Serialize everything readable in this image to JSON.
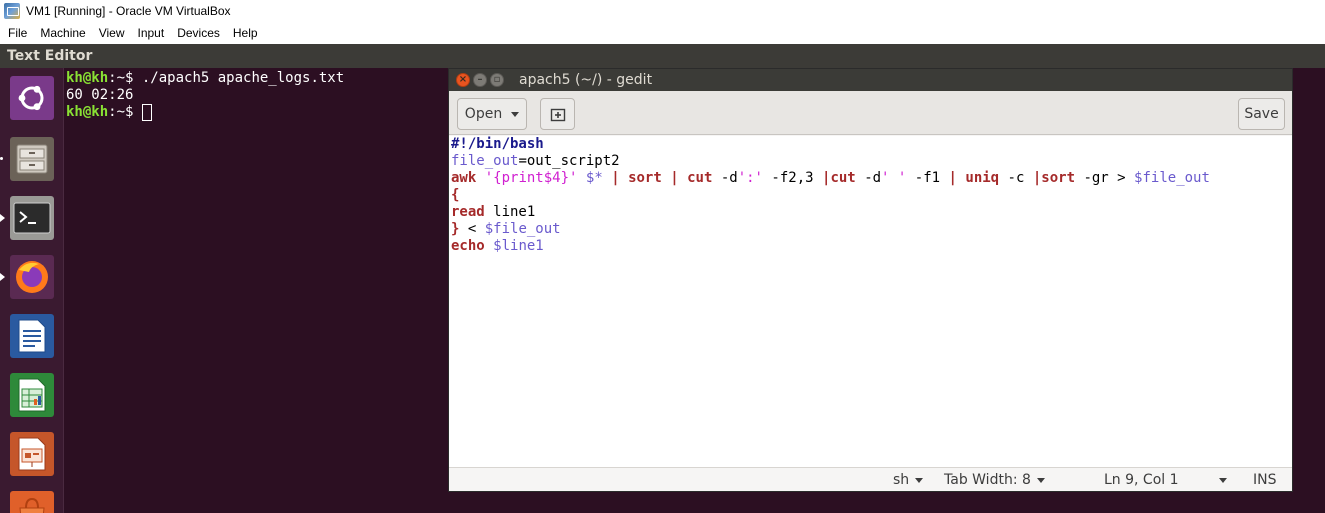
{
  "host": {
    "title": "VM1 [Running] - Oracle VM VirtualBox",
    "menu": [
      "File",
      "Machine",
      "View",
      "Input",
      "Devices",
      "Help"
    ]
  },
  "panel": {
    "title": "Text Editor"
  },
  "launcher": {
    "items": [
      {
        "name": "ubuntu-dash-icon"
      },
      {
        "name": "files-icon"
      },
      {
        "name": "terminal-icon"
      },
      {
        "name": "firefox-icon"
      },
      {
        "name": "writer-icon"
      },
      {
        "name": "calc-icon"
      },
      {
        "name": "impress-icon"
      },
      {
        "name": "software-icon"
      }
    ]
  },
  "terminal": {
    "user_host": "kh@kh",
    "path_prompt": ":~$ ",
    "command": "./apach5 apache_logs.txt",
    "output": "60 02:26"
  },
  "gedit": {
    "title": "apach5 (~/) - gedit",
    "open_label": "Open",
    "save_label": "Save",
    "lines": {
      "l1": "#!/bin/bash",
      "l2_var": "file_out",
      "l2_rest": "=out_script2",
      "l3": {
        "awk": "awk",
        "str1": "'{print$4}'",
        "var1": "$*",
        "pipe1": "|",
        "sort": "sort",
        "pipe2": "|",
        "cut1": "cut",
        "opt1": "-d",
        "str2": "':'",
        "opt2": "-f2,3",
        "pipe3": "|",
        "cut2": "cut",
        "opt3": "-d",
        "str3": "' '",
        "opt4": "-f1",
        "pipe4": "|",
        "uniq": "uniq",
        "opt5": "-c",
        "pipe5": "|",
        "sort2": "sort",
        "opt6": "-gr",
        "redir": ">",
        "var2": "$file_out"
      },
      "l4": "{",
      "l5_kw": "read",
      "l5_rest": " line1",
      "l6_kw": "}",
      "l6_rest": " < ",
      "l6_var": "$file_out",
      "l7_kw": "echo",
      "l7_var": "$line1"
    },
    "status": {
      "lang": "sh",
      "tab_width": "Tab Width: 8",
      "position": "Ln 9, Col 1",
      "mode": "INS"
    }
  }
}
